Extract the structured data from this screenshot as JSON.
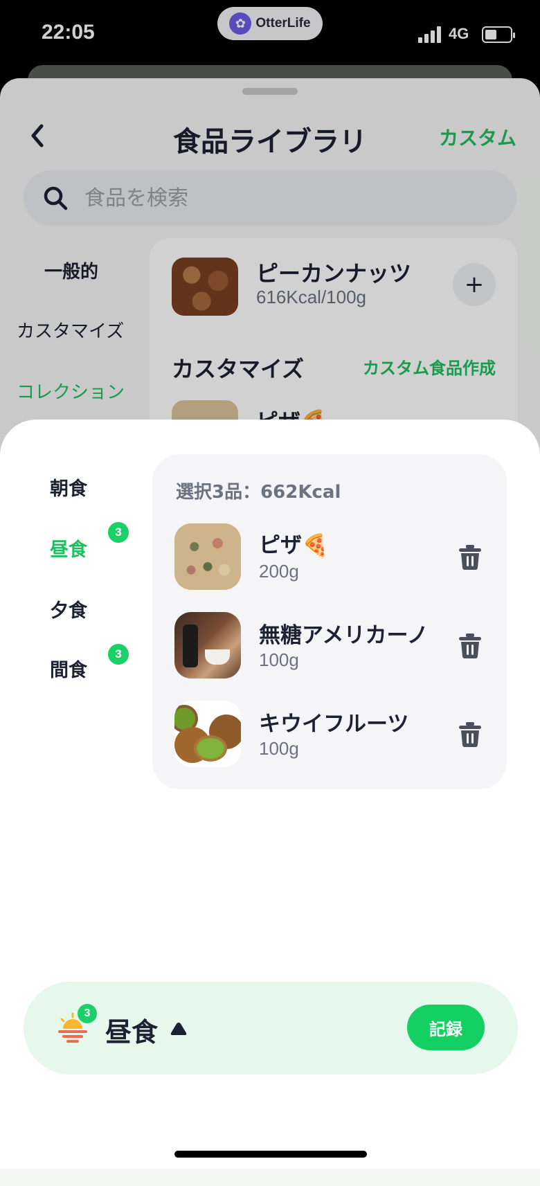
{
  "status_bar": {
    "time": "22:05",
    "app_pill": "OtterLife",
    "network": "4G"
  },
  "library": {
    "title": "食品ライブラリ",
    "custom_link": "カスタム",
    "search_placeholder": "食品を検索",
    "categories": [
      "一般的",
      "カスタマイズ",
      "コレクション"
    ],
    "active_category": "コレクション",
    "items": [
      {
        "name": "ピーカンナッツ",
        "kcal": "616Kcal/100g"
      }
    ],
    "section_title": "カスタマイズ",
    "section_link": "カスタム食品作成",
    "peek_item": "ピザ🍕"
  },
  "sheet": {
    "meals": [
      {
        "label": "朝食",
        "badge": ""
      },
      {
        "label": "昼食",
        "badge": "3"
      },
      {
        "label": "夕食",
        "badge": ""
      },
      {
        "label": "間食",
        "badge": "3"
      }
    ],
    "active_meal": "昼食",
    "summary": "選択3品：662Kcal",
    "selected": [
      {
        "name": "ピザ🍕",
        "weight": "200g",
        "image": "pizza-photo"
      },
      {
        "name": "無糖アメリカーノ",
        "weight": "100g",
        "image": "coffee-photo"
      },
      {
        "name": "キウイフルーツ",
        "weight": "100g",
        "image": "kiwi-photo"
      }
    ]
  },
  "bottom_bar": {
    "meal": "昼食",
    "badge": "3",
    "record_label": "記録"
  },
  "colors": {
    "accent": "#1dbf5f",
    "badge": "#1bd068",
    "bottom_bg": "#e6f8ec"
  }
}
